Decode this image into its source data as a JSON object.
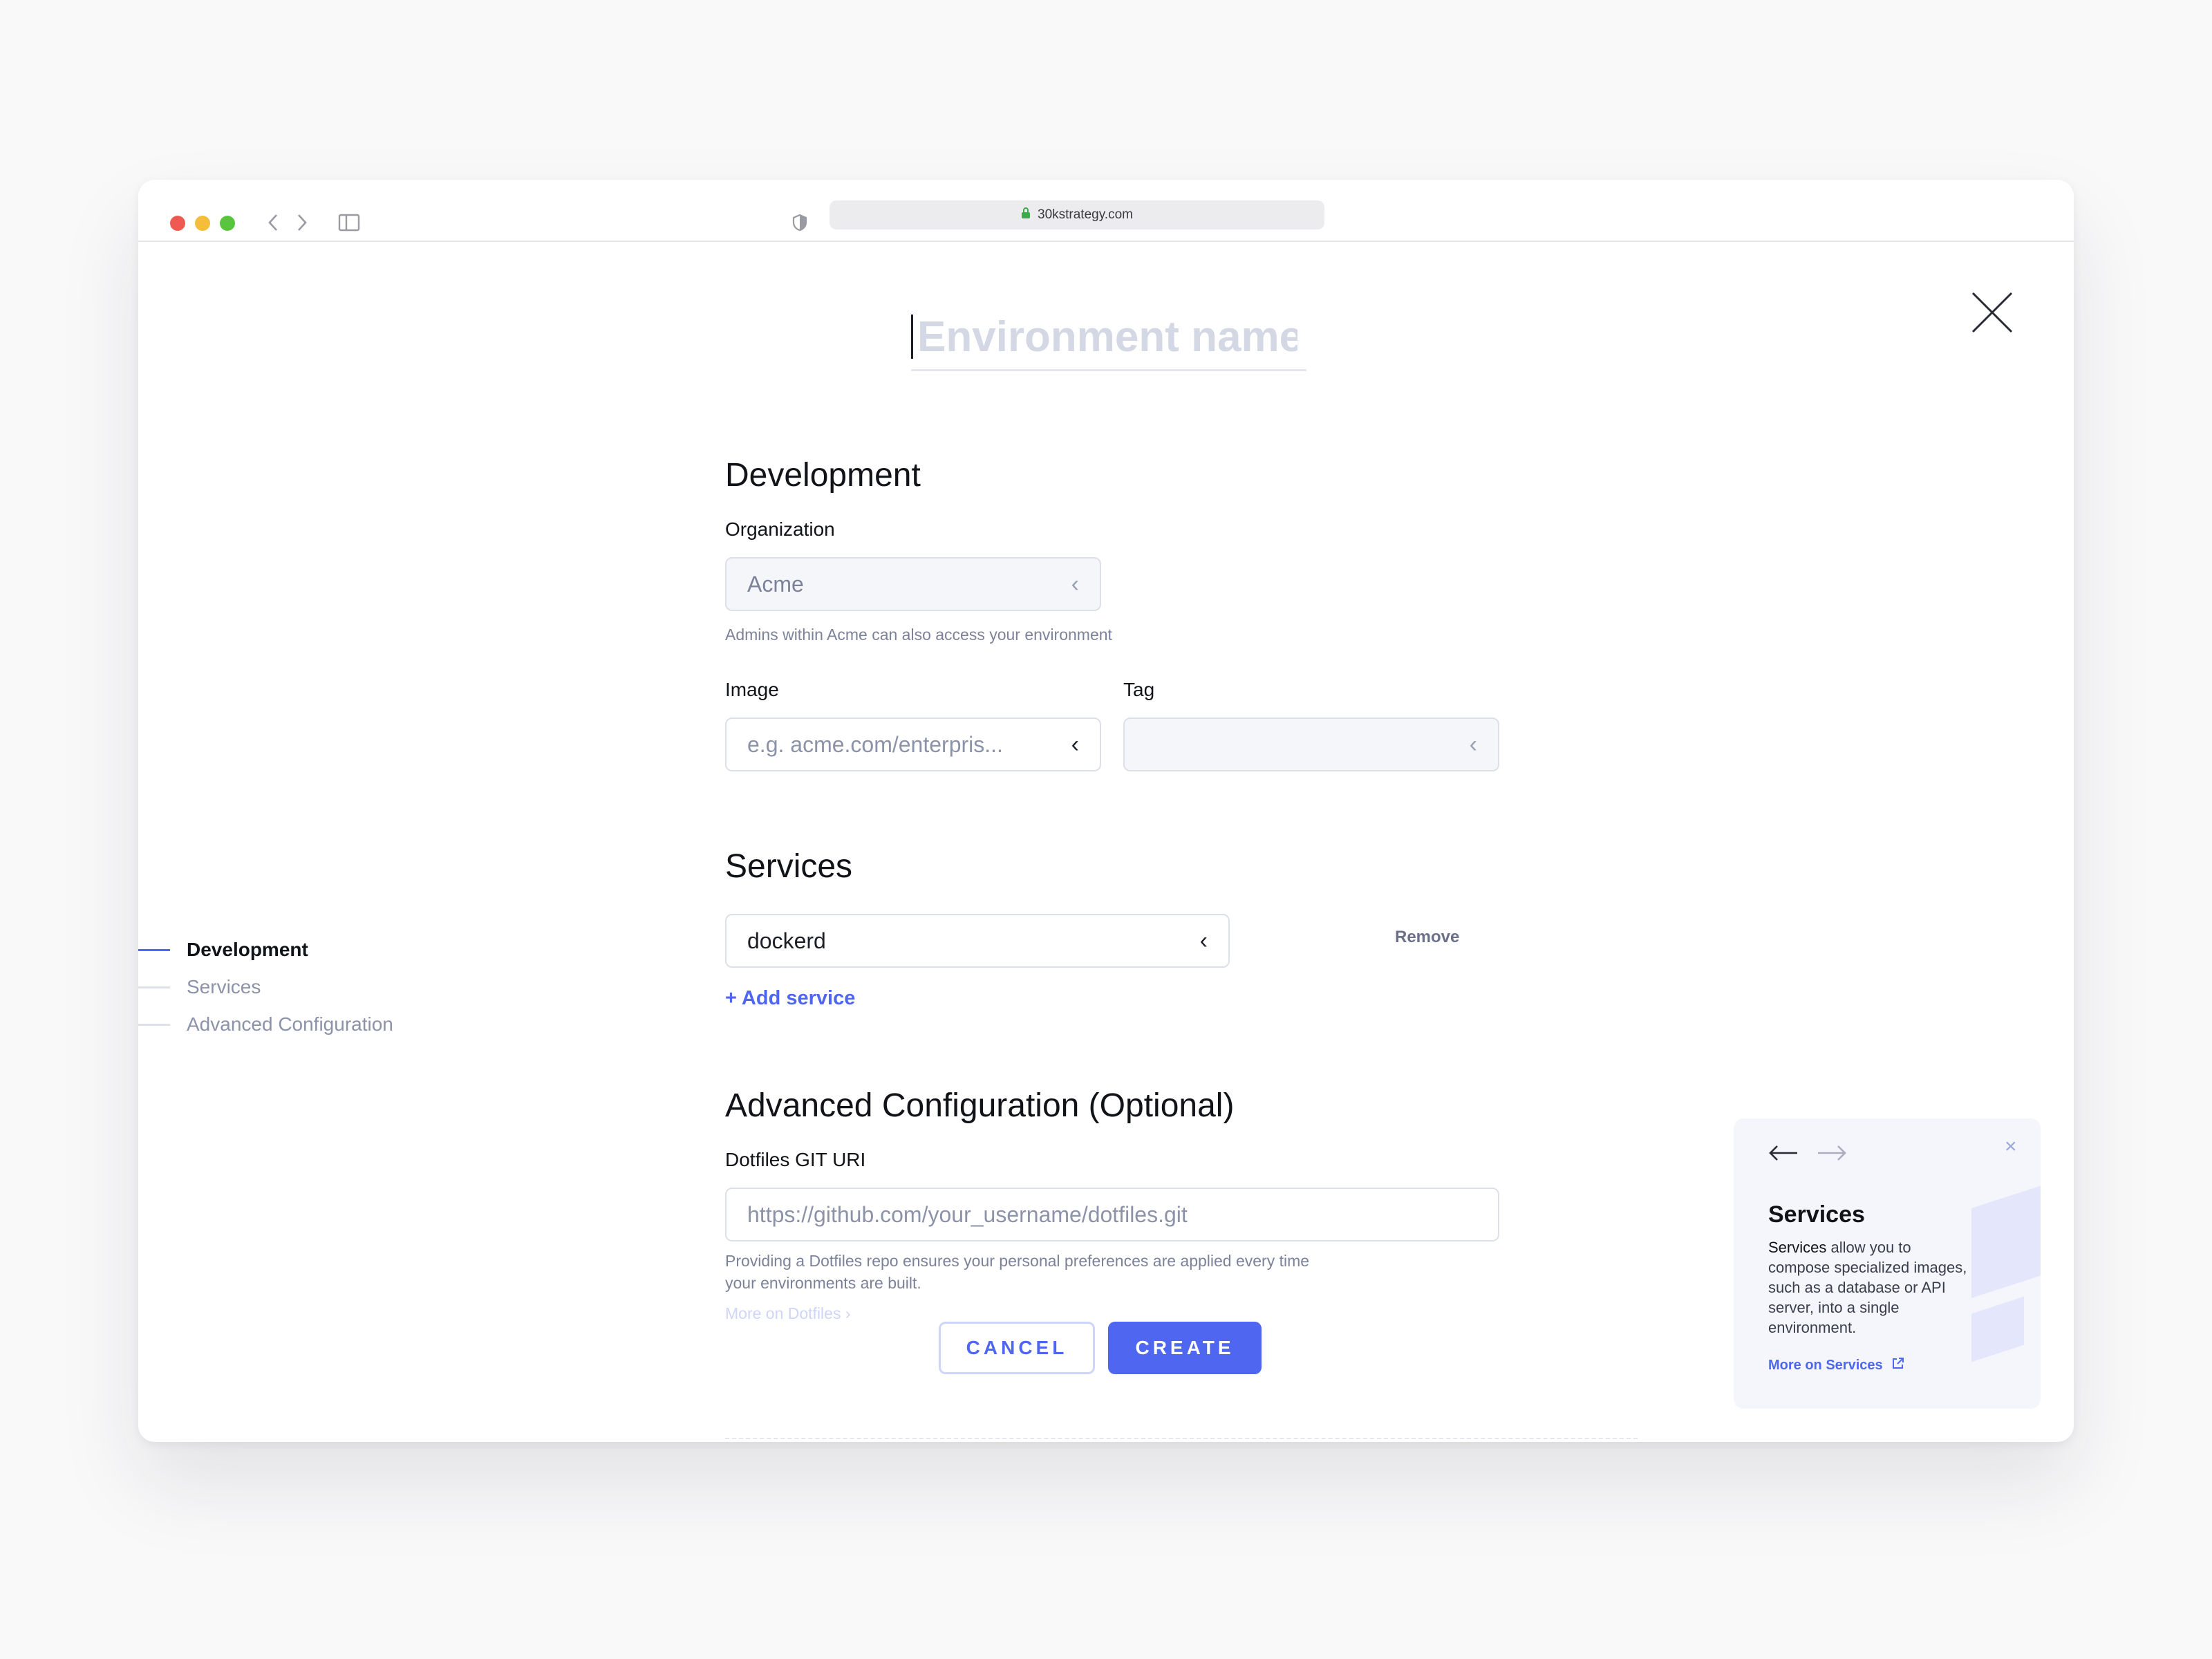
{
  "browser": {
    "url": "30kstrategy.com",
    "icons": [
      "back-icon",
      "forward-icon",
      "sidebar-icon",
      "shield-icon",
      "lock-icon",
      "share-icon",
      "tabs-icon"
    ]
  },
  "form": {
    "env_name_placeholder": "Environment name",
    "development": {
      "title": "Development",
      "org_label": "Organization",
      "org_value": "Acme",
      "org_hint": "Admins within Acme can also access your environment",
      "image_label": "Image",
      "image_placeholder": "e.g. acme.com/enterpris...",
      "tag_label": "Tag",
      "tag_value": ""
    },
    "services": {
      "title": "Services",
      "items": [
        {
          "value": "dockerd",
          "remove_label": "Remove"
        }
      ],
      "add_label": "+ Add service"
    },
    "advanced": {
      "title": "Advanced Configuration (Optional)",
      "dotfiles_label": "Dotfiles GIT URI",
      "dotfiles_placeholder": "https://github.com/your_username/dotfiles.git",
      "dotfiles_hint_1": "Providing a Dotfiles repo ensures your personal preferences are applied every time",
      "dotfiles_hint_2": "your environments are built.",
      "dotfiles_more": "More on Dotfiles ›"
    },
    "actions": {
      "cancel": "CANCEL",
      "create": "CREATE"
    }
  },
  "side_nav": {
    "items": [
      {
        "label": "Development",
        "active": true
      },
      {
        "label": "Services",
        "active": false
      },
      {
        "label": "Advanced Configuration",
        "active": false
      }
    ]
  },
  "help_card": {
    "title": "Services",
    "body_bold": "Services",
    "body_rest": " allow you to compose specialized images, such as a database or API server, into a single environment.",
    "more_label": "More on Services"
  },
  "colors": {
    "accent": "#4f66f0",
    "text": "#111319",
    "muted": "#7c8299",
    "border": "#dde0e8"
  }
}
